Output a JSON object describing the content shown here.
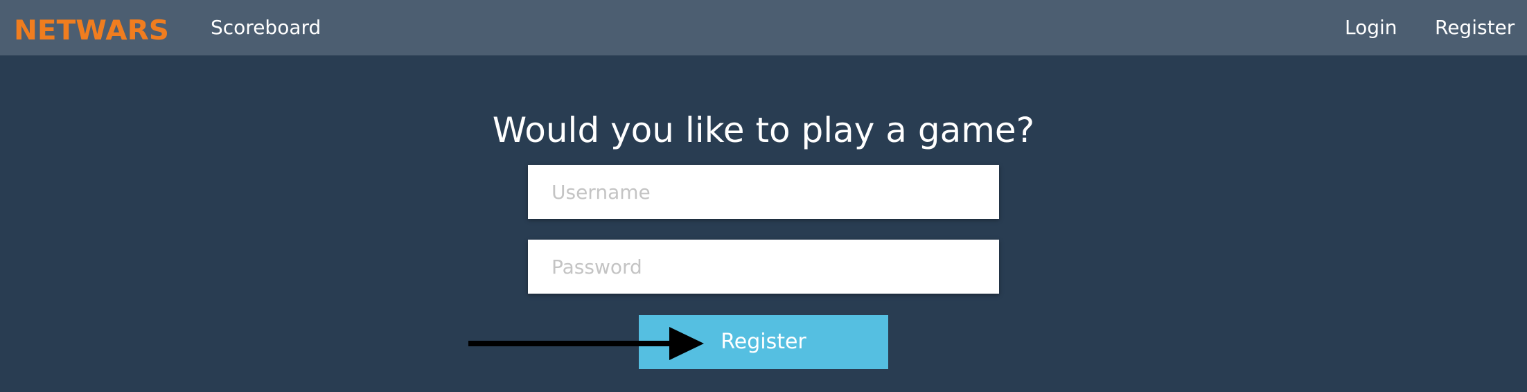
{
  "app": {
    "brand": "NETWARS",
    "brand_color": "#f07d1f",
    "accent_color": "#55bfe1",
    "background_color": "#293d52",
    "navbar_color": "#4c5e71"
  },
  "nav": {
    "scoreboard": "Scoreboard",
    "login": "Login",
    "register": "Register"
  },
  "form": {
    "headline": "Would you like to play a game?",
    "username_placeholder": "Username",
    "password_placeholder": "Password",
    "submit_label": "Register"
  },
  "annotation": {
    "icon": "arrow-right-icon",
    "color": "#000000"
  }
}
